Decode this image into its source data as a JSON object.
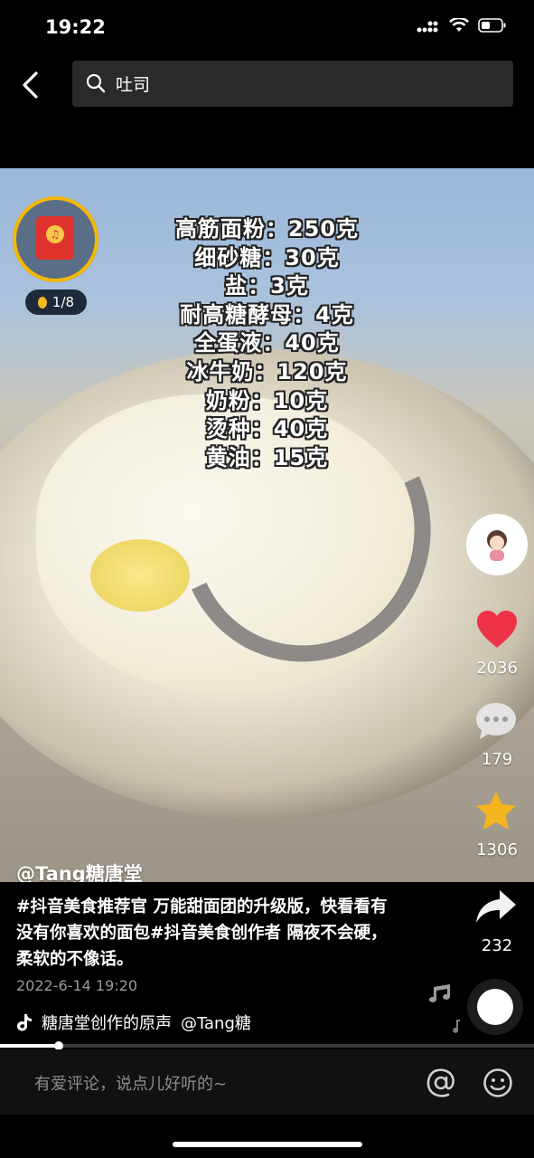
{
  "status_bar": {
    "time": "19:22"
  },
  "search": {
    "query": "吐司"
  },
  "video": {
    "ingredients": [
      "高筋面粉：250克",
      "细砂糖：30克",
      "盐：3克",
      "耐高糖酵母：4克",
      "全蛋液：40克",
      "冰牛奶：120克",
      "奶粉：10克",
      "烫种：40克",
      "黄油：15克"
    ],
    "author": "@Tang糖唐堂",
    "red_packet_count": "1/8"
  },
  "actions": {
    "like_count": "2036",
    "comment_count": "179",
    "favorite_count": "1306",
    "share_count": "232"
  },
  "caption": {
    "text": "#抖音美食推荐官 万能甜面团的升级版，快看看有没有你喜欢的面包#抖音美食创作者 隔夜不会硬，柔软的不像话。",
    "date": "2022-6-14 19:20"
  },
  "music": {
    "title": "糖唐堂创作的原声",
    "author": "@Tang糖"
  },
  "progress": {
    "fraction": 0.11
  },
  "comment": {
    "placeholder": "有爱评论，说点儿好听的~"
  },
  "colors": {
    "like": "#ee3348",
    "favorite": "#f6b51e",
    "redpacket": "#e0322d"
  }
}
